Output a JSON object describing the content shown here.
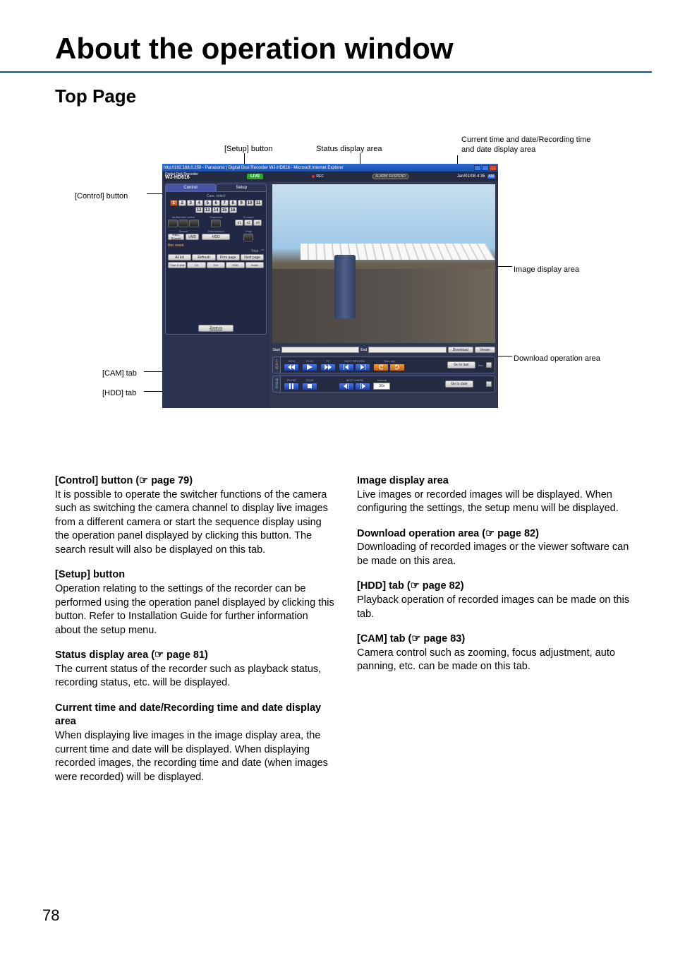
{
  "pageTitle": "About the operation window",
  "sectionTitle": "Top Page",
  "callouts": {
    "setup": "[Setup] button",
    "status": "Status display area",
    "datetime": "Current time and date/Recording time and date display area",
    "control": "[Control] button",
    "imgarea": "Image display area",
    "dlarea": "Download operation area",
    "cam": "[CAM] tab",
    "hdd": "[HDD] tab"
  },
  "window": {
    "title": "http://192.168.0.250 - Panasonic | Digital Disk Recorder WJ-HD616 - Microsoft Internet Explorer",
    "brandSmall": "Digital Disk Recorder",
    "brand": "WJ-HD616",
    "live": "LIVE",
    "rec": "REC",
    "alarm": "ALARM\nSUSPEND",
    "date": "Jan/01/08  4:35",
    "ampm": "AM",
    "tabs": {
      "control": "Control",
      "setup": "Setup"
    },
    "panel": {
      "camSelect": "Cam. select",
      "cams": [
        "1",
        "2",
        "3",
        "4",
        "5",
        "6",
        "7",
        "8",
        "9",
        "10",
        "11",
        "12",
        "13",
        "14",
        "15",
        "16"
      ],
      "multi": "Multiscreen select",
      "sequence": "Sequence",
      "elzoom": "El-zoom",
      "elz": [
        "x1",
        "x2",
        "x4"
      ],
      "search": "Search",
      "recEvent": "REC Event",
      "vmd": "VMD",
      "diskmed": "Disk/Medium",
      "hddBtn": "HDD",
      "copy": "Copy",
      "recEventHdr": "Rec event",
      "total": "Total : **",
      "allList": "All list",
      "refresh": "Refresh",
      "prev": "Prev page",
      "next": "Next page",
      "c1": "Time & date",
      "c2": "Ch",
      "c3": "Evt",
      "c4": "HDD",
      "c5": "Audio",
      "zoomIn": "Zoom in"
    },
    "dl": {
      "start": "Start",
      "end": "End",
      "download": "Download",
      "viewer": "Viewer"
    },
    "camstrip": {
      "tab": "CAM",
      "rew": "REW",
      "play": "PLAY",
      "ff": "FF",
      "nextrec": "NEXT RECORD",
      "timeslip": "Time slip",
      "pause": "PAUSE",
      "stop": "STOP",
      "nextimg": "NEXT IMAGE",
      "interval": "Interval",
      "goLast": "Go to last",
      "goDate": "Go to date",
      "rec": "Rec",
      "sel": "30s"
    },
    "hddstrip": {
      "tab": "HDD"
    }
  },
  "left": {
    "p1h": "[Control] button (☞ page 79)",
    "p1": "It is possible to operate the switcher functions of the camera such as switching the camera channel to display live images from a different camera or start the sequence display using the operation panel displayed by clicking this button. The search result will also be displayed on this tab.",
    "p2h": "[Setup] button",
    "p2": "Operation relating to the settings of the recorder can be performed using the operation panel displayed by clicking this button. Refer to Installation Guide for further information about the setup menu.",
    "p3h": "Status display area (☞ page 81)",
    "p3": "The current status of the recorder such as playback status, recording status, etc. will be displayed.",
    "p4h": "Current time and date/Recording time and date display area",
    "p4": "When displaying live images in the image display area, the current time and date will be displayed. When displaying recorded images, the recording time and date (when images were recorded) will be displayed."
  },
  "right": {
    "p1h": "Image display area",
    "p1": "Live images or recorded images will be displayed. When configuring the settings, the setup menu will be displayed.",
    "p2h": "Download operation area (☞ page 82)",
    "p2": "Downloading of recorded images or the viewer software can be made on this area.",
    "p3h": "[HDD] tab (☞ page 82)",
    "p3": "Playback operation of recorded images can be made on this tab.",
    "p4h": "[CAM] tab (☞ page 83)",
    "p4": "Camera control such as zooming, focus adjustment, auto panning, etc. can be made on this tab."
  },
  "pageNum": "78"
}
